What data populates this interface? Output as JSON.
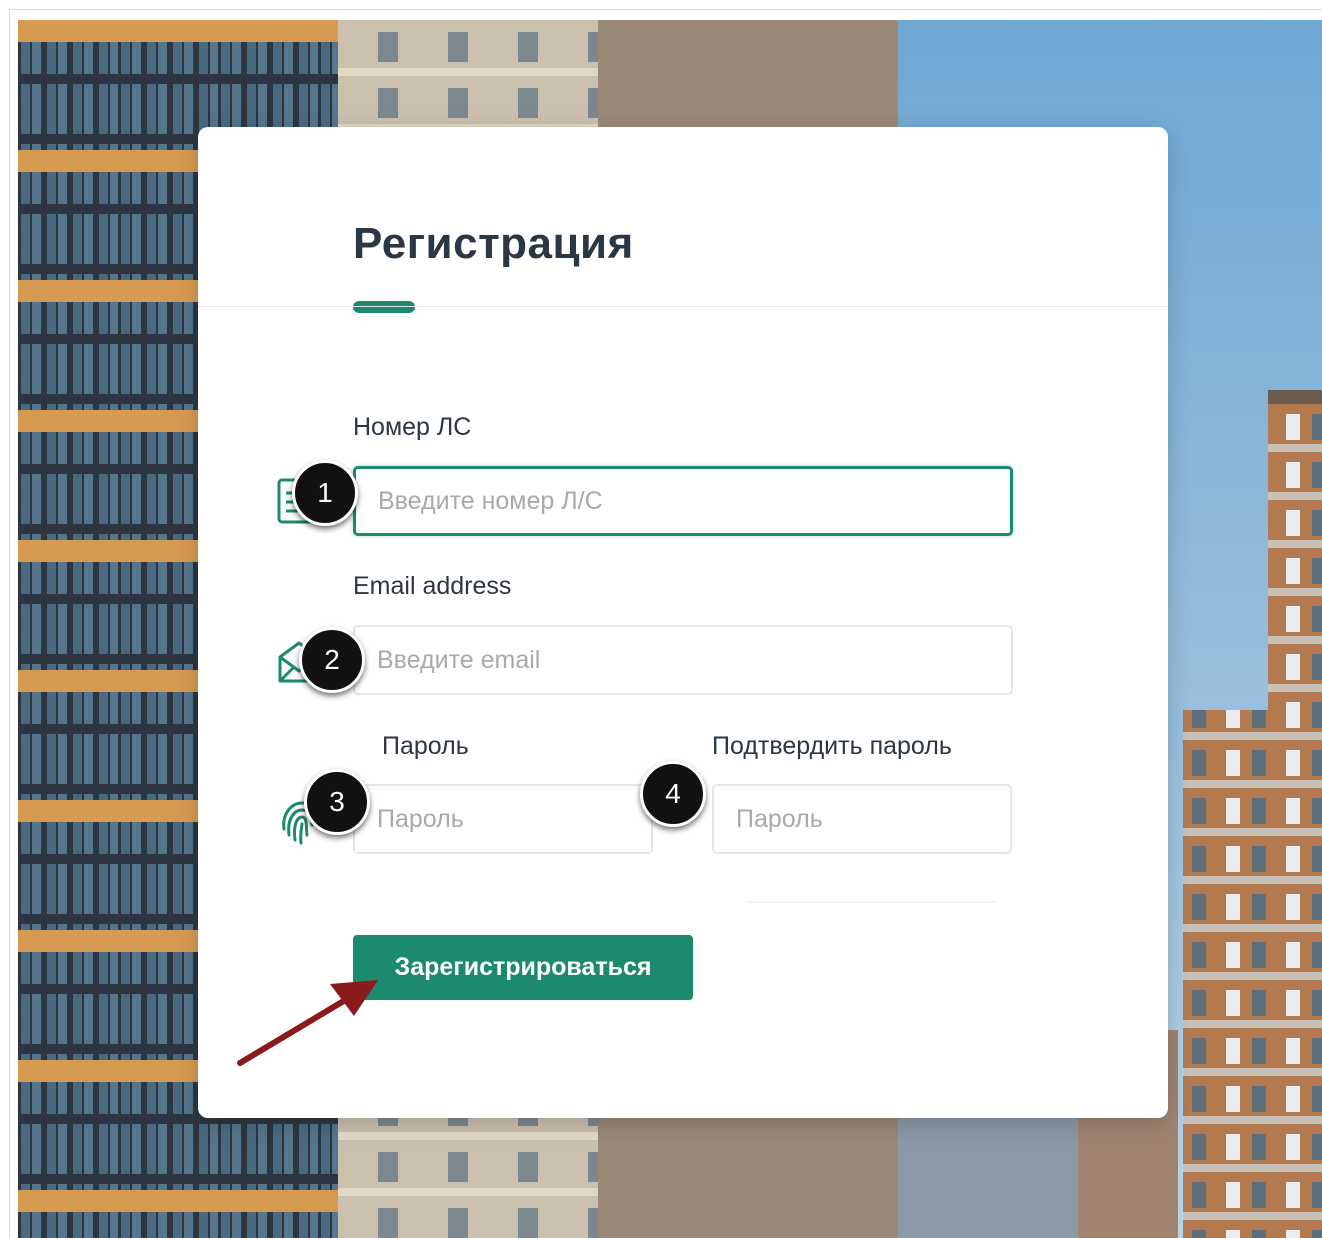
{
  "form": {
    "title": "Регистрация",
    "account": {
      "label": "Номер ЛС",
      "placeholder": "Введите номер Л/С"
    },
    "email": {
      "label": "Email address",
      "placeholder": "Введите email"
    },
    "password": {
      "label": "Пароль",
      "placeholder": "Пароль"
    },
    "confirm": {
      "label": "Подтвердить пароль",
      "placeholder": "Пароль"
    },
    "submit_label": "Зарегистрироваться"
  },
  "callouts": [
    "1",
    "2",
    "3",
    "4"
  ],
  "icons": {
    "account": "document-icon",
    "email": "envelope-icon",
    "password": "fingerprint-icon"
  },
  "colors": {
    "accent": "#1b8a6e",
    "title": "#2a3744",
    "callout_arrow": "#8b1a1a"
  }
}
